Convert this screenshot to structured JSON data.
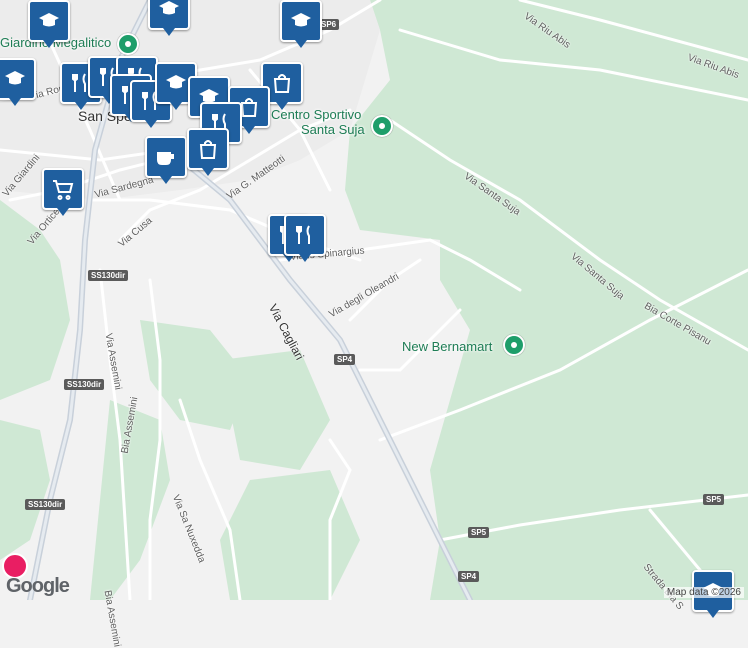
{
  "town": "San Sperate",
  "pois": {
    "giardino": "Giardino Megalitico",
    "centro_sportivo_1": "Centro Sportivo",
    "centro_sportivo_2": "Santa Suja",
    "bernamart": "New Bernamart"
  },
  "streets": {
    "riu_abis_1": "Via Riu Abis",
    "riu_abis_2": "Via Riu Abis",
    "santa_suja_1": "Via Santa Suja",
    "santa_suja_2": "Via Santa Suja",
    "corte_pisanu": "Bia Corte Pisanu",
    "roma": "Via Roma",
    "giardini": "Via Giardini",
    "orticello": "Via Orticello",
    "sardegna": "Via Sardegna",
    "cusa": "Via Cusa",
    "matteotti": "Via G. Matteotti",
    "is_spinargius": "Via Is Spinargius",
    "cagliari": "Via Cagliari",
    "oleandri": "Via degli Oleandri",
    "assemini_1": "Via Assemini",
    "assemini_2": "Bia Assemini",
    "assemini_3": "Bia Assemini",
    "sa_nuxedda": "Via Sa Nuxedda",
    "strada": "Strada Bia S"
  },
  "shields": {
    "sp6": "SP6",
    "ss130_1": "SS130dir",
    "ss130_2": "SS130dir",
    "ss130_3": "SS130dir",
    "sp4_1": "SP4",
    "sp4_2": "SP4",
    "sp5_1": "SP5",
    "sp5_2": "SP5"
  },
  "footer": {
    "map_data": "Map data ©2026",
    "logo": "Google"
  },
  "colors": {
    "park_green": "#cfe8d4",
    "pin_blue": "#1f5f9f",
    "poi_green": "#1e9e6a",
    "road": "#ffffff",
    "highway": "#c8d0da"
  }
}
